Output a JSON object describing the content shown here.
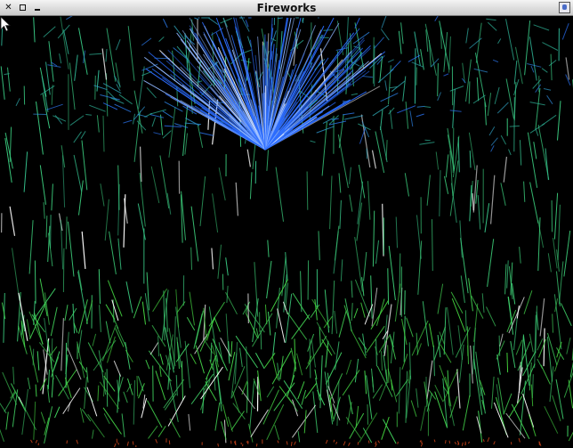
{
  "window": {
    "title": "Fireworks",
    "controls": {
      "close_icon": "close-icon",
      "maximize_icon": "maximize-icon",
      "minimize_icon": "minimize-icon",
      "app_icon": "app-menu-icon"
    }
  },
  "scene": {
    "background_color": "#000000",
    "palette": {
      "burst_blue": "#2b6cff",
      "burst_light_blue": "#8fb6ff",
      "streak_green": "#3fd06a",
      "streak_teal": "#2fb79a",
      "streak_white": "#ffffff",
      "grass_green": "#44d23a",
      "ember_red": "#c0401a"
    },
    "burst_count": 1,
    "falling_streak_count": 420,
    "ground_strand_count": 360
  }
}
